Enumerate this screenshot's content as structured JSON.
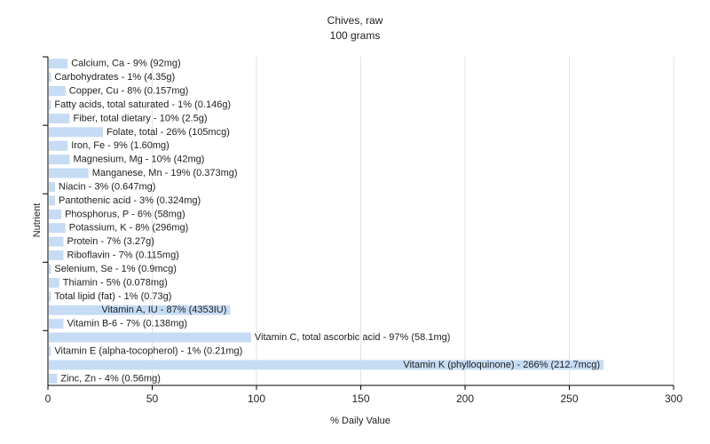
{
  "chart_data": {
    "type": "bar",
    "orientation": "horizontal",
    "title": "Chives, raw",
    "subtitle": "100 grams",
    "xlabel": "% Daily Value",
    "ylabel": "Nutrient",
    "xlim": [
      0,
      300
    ],
    "xticks": [
      0,
      50,
      100,
      150,
      200,
      250,
      300
    ],
    "grid": true,
    "bar_color": "#c6dcf5",
    "bars": [
      {
        "label": "Calcium, Ca - 9% (92mg)",
        "value": 9
      },
      {
        "label": "Carbohydrates - 1% (4.35g)",
        "value": 1
      },
      {
        "label": "Copper, Cu - 8% (0.157mg)",
        "value": 8
      },
      {
        "label": "Fatty acids, total saturated - 1% (0.146g)",
        "value": 1
      },
      {
        "label": "Fiber, total dietary - 10% (2.5g)",
        "value": 10
      },
      {
        "label": "Folate, total - 26% (105mcg)",
        "value": 26
      },
      {
        "label": "Iron, Fe - 9% (1.60mg)",
        "value": 9
      },
      {
        "label": "Magnesium, Mg - 10% (42mg)",
        "value": 10
      },
      {
        "label": "Manganese, Mn - 19% (0.373mg)",
        "value": 19
      },
      {
        "label": "Niacin - 3% (0.647mg)",
        "value": 3
      },
      {
        "label": "Pantothenic acid - 3% (0.324mg)",
        "value": 3
      },
      {
        "label": "Phosphorus, P - 6% (58mg)",
        "value": 6
      },
      {
        "label": "Potassium, K - 8% (296mg)",
        "value": 8
      },
      {
        "label": "Protein - 7% (3.27g)",
        "value": 7
      },
      {
        "label": "Riboflavin - 7% (0.115mg)",
        "value": 7
      },
      {
        "label": "Selenium, Se - 1% (0.9mcg)",
        "value": 1
      },
      {
        "label": "Thiamin - 5% (0.078mg)",
        "value": 5
      },
      {
        "label": "Total lipid (fat) - 1% (0.73g)",
        "value": 1
      },
      {
        "label": "Vitamin A, IU - 87% (4353IU)",
        "value": 87
      },
      {
        "label": "Vitamin B-6 - 7% (0.138mg)",
        "value": 7
      },
      {
        "label": "Vitamin C, total ascorbic acid - 97% (58.1mg)",
        "value": 97
      },
      {
        "label": "Vitamin E (alpha-tocopherol) - 1% (0.21mg)",
        "value": 1
      },
      {
        "label": "Vitamin K (phylloquinone) - 266% (212.7mcg)",
        "value": 266
      },
      {
        "label": "Zinc, Zn - 4% (0.56mg)",
        "value": 4
      }
    ]
  }
}
